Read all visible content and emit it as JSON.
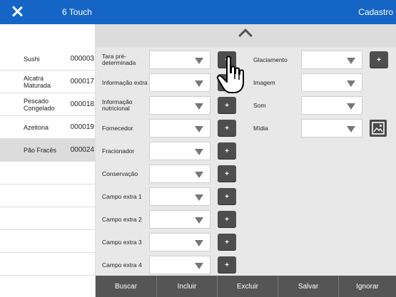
{
  "header": {
    "title": "6 Touch",
    "right_label": "Cadastro",
    "color": "#1565c7"
  },
  "list": [
    {
      "name": "Sushi",
      "code": "000003"
    },
    {
      "name": "Alcatra Maturada",
      "code": "000017"
    },
    {
      "name": "Pescado Congelado",
      "code": "000018"
    },
    {
      "name": "Azeitona",
      "code": "000019"
    },
    {
      "name": "Pão Fracês",
      "code": "000024"
    }
  ],
  "selected_index": 4,
  "form": {
    "fields_left": [
      {
        "label": "Tara pré-determinada"
      },
      {
        "label": "Informação extra"
      },
      {
        "label": "Informação nutricional"
      },
      {
        "label": "Fornecedor"
      },
      {
        "label": "Fracionador"
      },
      {
        "label": "Conservação"
      },
      {
        "label": "Campo extra 1"
      },
      {
        "label": "Campo extra 2"
      },
      {
        "label": "Campo extra 3"
      },
      {
        "label": "Campo extra 4"
      }
    ],
    "fields_right": [
      {
        "label": "Glaciamento"
      },
      {
        "label": "Imagem"
      },
      {
        "label": "Som"
      },
      {
        "label": "Mídia"
      }
    ],
    "add_label": "+"
  },
  "bottom": {
    "buscar": "Buscar",
    "incluir": "Incluir",
    "excluir": "Excluir",
    "salvar": "Salvar",
    "ignorar": "Ignorar"
  }
}
